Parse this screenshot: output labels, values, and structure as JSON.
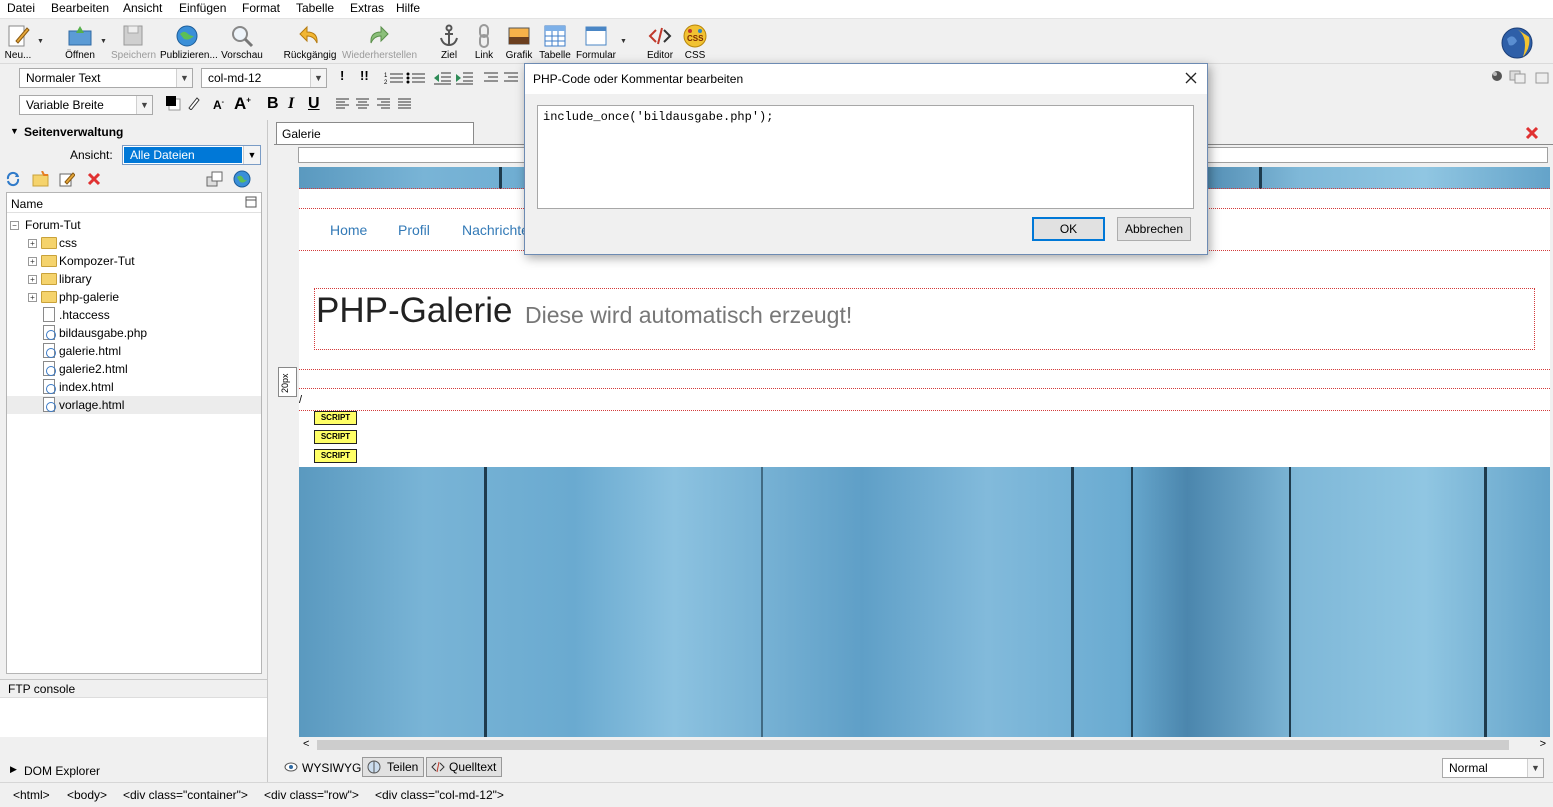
{
  "menu": [
    "Datei",
    "Bearbeiten",
    "Ansicht",
    "Einfügen",
    "Format",
    "Tabelle",
    "Extras",
    "Hilfe"
  ],
  "toolbar": {
    "new": "Neu...",
    "open": "Öffnen",
    "save": "Speichern",
    "publish": "Publizieren...",
    "preview": "Vorschau",
    "undo": "Rückgängig",
    "redo": "Wiederherstellen",
    "anchor": "Ziel",
    "link": "Link",
    "image": "Grafik",
    "table": "Tabelle",
    "form": "Formular",
    "editor": "Editor",
    "css": "CSS",
    "css_icon_text": "CSS"
  },
  "format": {
    "paragraph_style": "Normaler Text",
    "class_select": "col-md-12",
    "font_select": "Variable Breite",
    "bold": "B",
    "italic": "I",
    "underline": "U"
  },
  "site_manager": {
    "title": "Seitenverwaltung",
    "view_label": "Ansicht:",
    "view_value": "Alle Dateien",
    "column_name": "Name",
    "tree": [
      {
        "label": "Forum-Tut",
        "type": "root"
      },
      {
        "label": "css",
        "type": "folder"
      },
      {
        "label": "Kompozer-Tut",
        "type": "folder"
      },
      {
        "label": "library",
        "type": "folder"
      },
      {
        "label": "php-galerie",
        "type": "folder"
      },
      {
        "label": ".htaccess",
        "type": "file"
      },
      {
        "label": "bildausgabe.php",
        "type": "web"
      },
      {
        "label": "galerie.html",
        "type": "web"
      },
      {
        "label": "galerie2.html",
        "type": "web"
      },
      {
        "label": "index.html",
        "type": "web"
      },
      {
        "label": "vorlage.html",
        "type": "web"
      }
    ]
  },
  "ftp_console": "FTP console",
  "dom_explorer": "DOM Explorer",
  "document": {
    "tab": "Galerie",
    "nav": [
      "Home",
      "Profil",
      "Nachrichten"
    ],
    "heading": "PHP-Galerie",
    "subheading": "Diese wird automatisch erzeugt!",
    "ruler_label": "20px",
    "slash": "/",
    "script_badges": [
      "SCRIPT",
      "SCRIPT",
      "SCRIPT"
    ]
  },
  "dialog": {
    "title": "PHP-Code oder Kommentar bearbeiten",
    "code": "include_once('bildausgabe.php');",
    "ok": "OK",
    "cancel": "Abbrechen"
  },
  "view_tabs": [
    "WYSIWYG",
    "Teilen",
    "Quelltext"
  ],
  "zoom_select": "Normal",
  "status_path": [
    "<html>",
    "<body>",
    "<div class=\"container\">",
    "<div class=\"row\">",
    "<div class=\"col-md-12\">"
  ],
  "colors": {
    "link": "#337ab7",
    "selection": "#0078d7",
    "red_x": "#e03131",
    "dialog_border": "#6d8bb3"
  }
}
